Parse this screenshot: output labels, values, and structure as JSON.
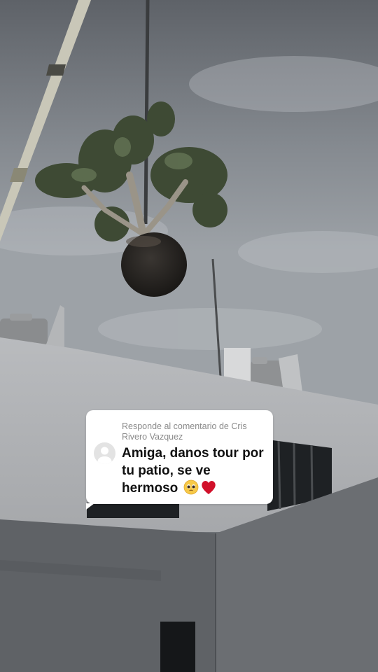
{
  "photo": {
    "description_icons": [
      "crane-boom",
      "hanging-tree",
      "building",
      "water-tanks",
      "cloudy-sky"
    ]
  },
  "reply_card": {
    "header": "Responde al comentario de Cris Rivero Vazquez",
    "comment": "Amiga, danos tour por tu patio, se ve hermoso",
    "emojis": [
      "pleading-face-icon",
      "red-heart-icon"
    ]
  }
}
